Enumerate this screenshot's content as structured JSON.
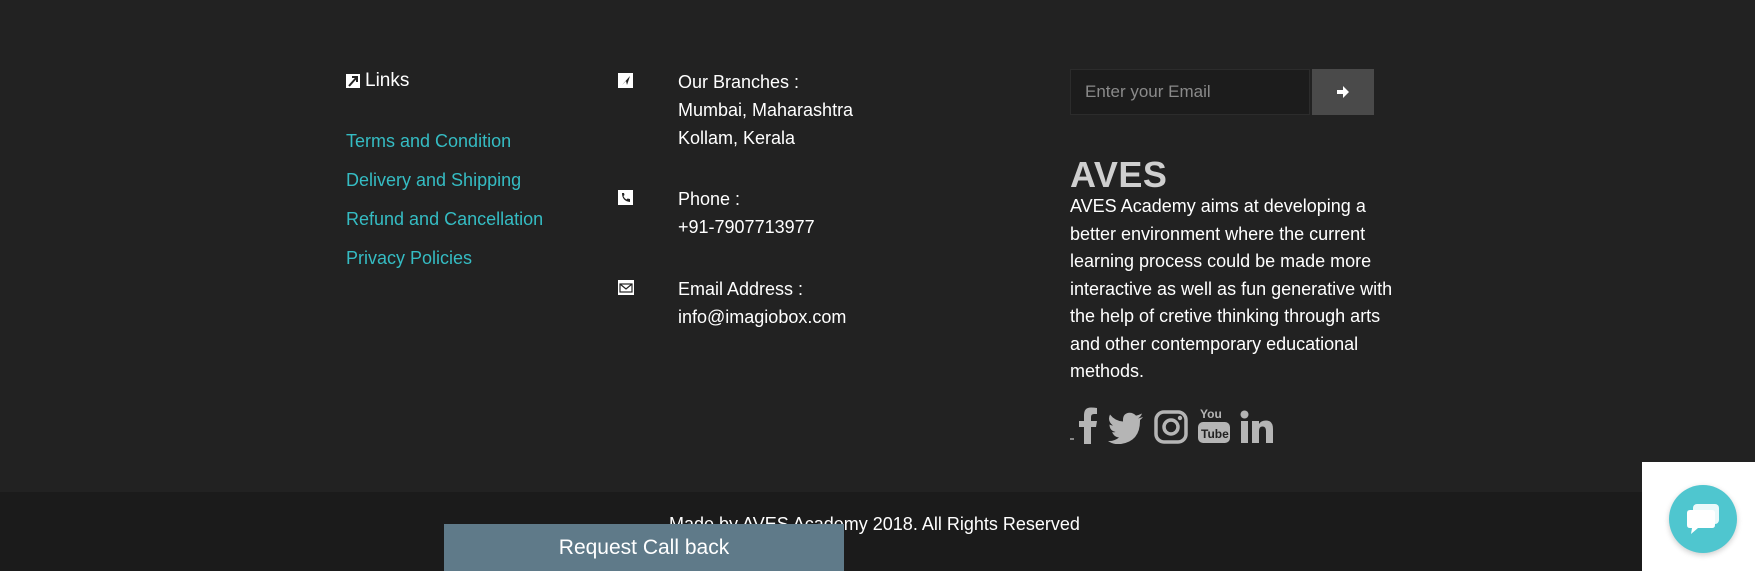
{
  "links": {
    "heading": "Links",
    "items": [
      {
        "label": "Terms and Condition"
      },
      {
        "label": "Delivery and Shipping"
      },
      {
        "label": "Refund and Cancellation"
      },
      {
        "label": "Privacy Policies"
      }
    ]
  },
  "contact": {
    "branches_label": "Our Branches :",
    "branches": [
      "Mumbai, Maharashtra",
      "Kollam, Kerala"
    ],
    "phone_label": "Phone :",
    "phone": "+91-7907713977",
    "email_label": "Email Address :",
    "email": "info@imagiobox.com"
  },
  "newsletter": {
    "placeholder": "Enter your Email"
  },
  "brand": {
    "name": "AVES",
    "description": "AVES Academy aims at developing a better environment where the current learning process could be made more interactive as well as fun generative with the help of cretive thinking through arts and other contemporary educational methods."
  },
  "social": [
    "facebook-icon",
    "twitter-icon",
    "instagram-icon",
    "youtube-icon",
    "linkedin-icon"
  ],
  "copyright": "Made by AVES Academy 2018. All Rights Reserved",
  "request_callback": "Request Call back",
  "colors": {
    "background": "#222222",
    "link": "#35bcc3",
    "request_button": "#5f7a89",
    "chat_button": "#4fc6cf"
  }
}
